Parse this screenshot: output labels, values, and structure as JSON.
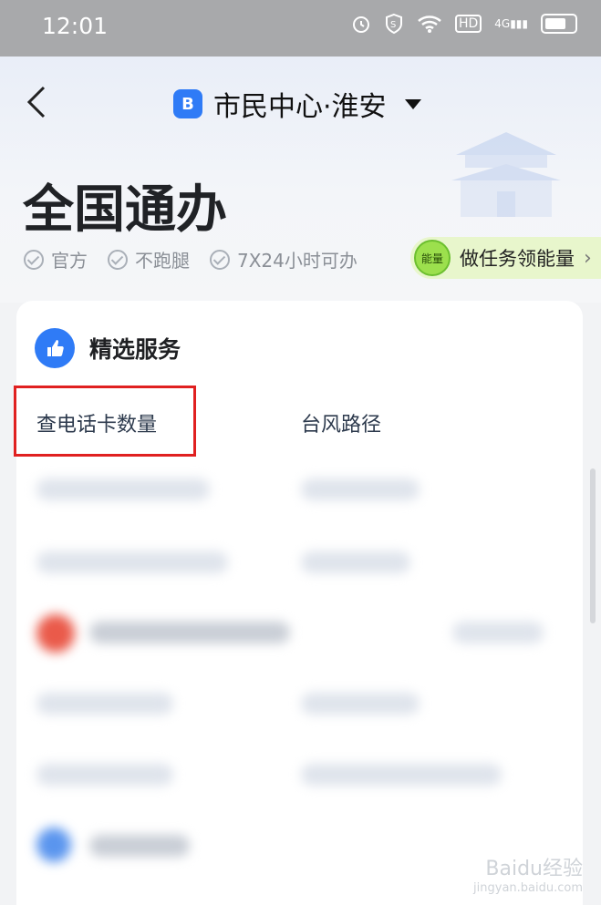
{
  "status_bar": {
    "time": "12:01",
    "icons": [
      "alarm-icon",
      "shield-icon",
      "wifi-icon",
      "hd-icon",
      "signal-4g-icon",
      "battery-icon"
    ],
    "hd": "HD",
    "net": "4G"
  },
  "header": {
    "app_logo_letter": "B",
    "app_title": "市民中心·淮安"
  },
  "hero": {
    "title": "全国通办",
    "badges": [
      "官方",
      "不跑腿",
      "7X24小时可办"
    ],
    "energy": {
      "icon_text": "能量",
      "label": "做任务领能量",
      "chevron": "›"
    }
  },
  "featured": {
    "title": "精选服务",
    "items": [
      "查电话卡数量",
      "台风路径"
    ]
  },
  "watermark": {
    "line1": "Baidu经验",
    "line2": "jingyan.baidu.com"
  },
  "colors": {
    "accent": "#2f7bf6",
    "highlight": "#e02020",
    "energy_bg": "#e8f6cc"
  }
}
